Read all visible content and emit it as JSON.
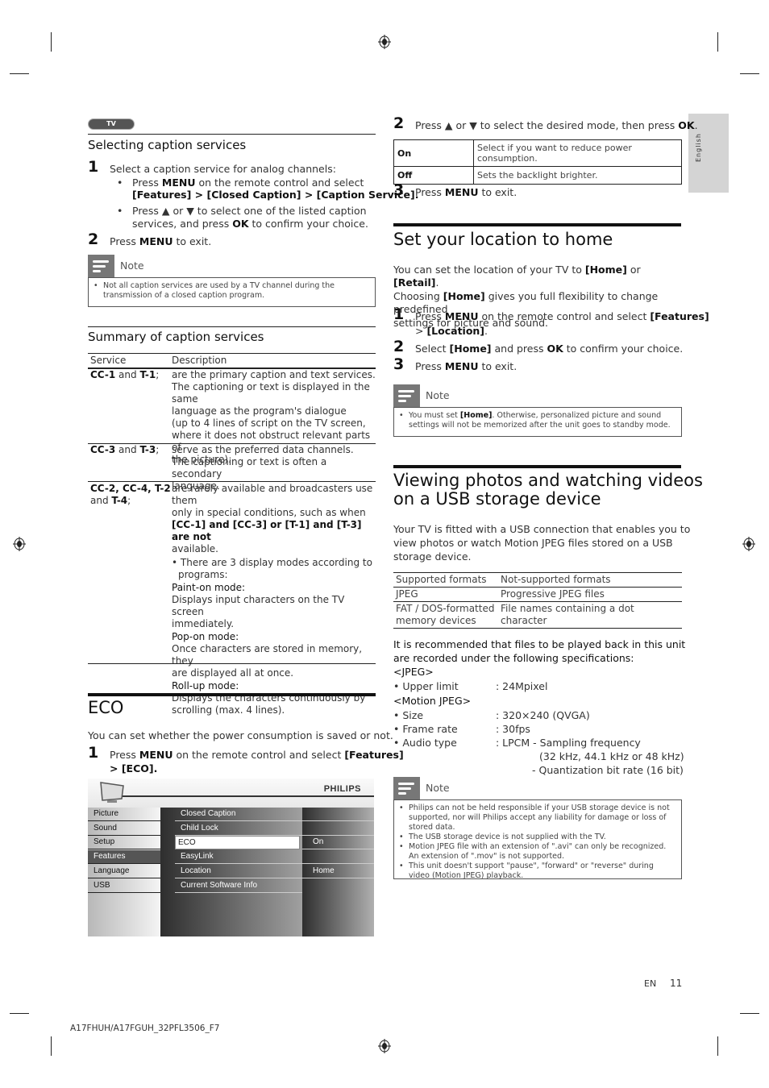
{
  "page": {
    "language_tab": "English",
    "footer": {
      "lang": "EN",
      "page_number": "11",
      "model": "A17FHUH/A17FGUH_32PFL3506_F7"
    }
  },
  "left": {
    "badge": "TV",
    "caption_section": {
      "title": "Selecting caption services",
      "step1_num": "1",
      "step1": "Select a caption service for analog channels:",
      "bullet1_pre": "Press ",
      "bullet1_menu": "MENU",
      "bullet1_mid": " on the remote control and select",
      "bullet1_path": "[Features] > [Closed Caption] > [Caption Service].",
      "bullet2_pre": "Press ▲ or ▼ to select one of the listed caption",
      "bullet2_line2_pre": "services, and press ",
      "bullet2_ok": "OK",
      "bullet2_post": " to confirm your choice.",
      "step2_num": "2",
      "step2_pre": "Press ",
      "step2_menu": "MENU",
      "step2_post": " to exit.",
      "note_label": "Note",
      "note_items": [
        "Not all caption services are used by a TV channel during the transmission of a closed caption program."
      ]
    },
    "summary": {
      "title": "Summary of caption services",
      "headers": [
        "Service",
        "Description"
      ],
      "rows": [
        {
          "service_bold1": "CC-1",
          "service_mid": " and ",
          "service_bold2": "T-1",
          "service_post": ";",
          "desc": [
            "are the primary caption and text services.",
            "The captioning or text is displayed in the same",
            "language as the program's dialogue",
            "(up to 4 lines of script on the TV screen,",
            "where it does not obstruct relevant parts of",
            "the picture)."
          ]
        },
        {
          "service_bold1": "CC-3",
          "service_mid": " and ",
          "service_bold2": "T-3",
          "service_post": ";",
          "desc": [
            "serve as the preferred data channels.",
            "The captioning or text is often a secondary",
            "language."
          ]
        },
        {
          "service_line1": "CC-2, CC-4, T-2",
          "service_line2_pre": "and ",
          "service_line2_bold": "T-4",
          "service_line2_post": ";",
          "desc_intro": [
            "are rarely available and broadcasters use them",
            "only in special conditions, such as when"
          ],
          "desc_codes": "[CC-1] and [CC-3] or [T-1] and [T-3] are not",
          "desc_avail": "available.",
          "desc_bullet": [
            "• There are 3 display modes according to",
            "programs:"
          ],
          "modes": [
            {
              "name": "Paint-on mode:",
              "text": [
                "Displays input characters on the TV screen",
                "immediately."
              ]
            },
            {
              "name": "Pop-on mode:",
              "text": [
                "Once characters are stored in memory, they",
                "are displayed all at once."
              ]
            },
            {
              "name": "Roll-up mode:",
              "text": [
                "Displays the characters continuously by",
                "scrolling (max. 4 lines)."
              ]
            }
          ]
        }
      ]
    },
    "eco": {
      "title": "ECO",
      "intro": "You can set whether the power consumption is saved or not.",
      "step1_num": "1",
      "step1_pre": "Press ",
      "step1_menu": "MENU",
      "step1_mid": " on the remote control and select ",
      "step1_features": "[Features]",
      "step1_line2": "> [ECO].",
      "tv_menu": {
        "brand": "PHILIPS",
        "left_items": [
          "Picture",
          "Sound",
          "Setup",
          "Features",
          "Language",
          "USB"
        ],
        "left_selected": "Features",
        "mid_items": [
          "Closed Caption",
          "Child Lock",
          "ECO",
          "EasyLink",
          "Location",
          "Current Software Info"
        ],
        "mid_selected": "ECO",
        "right_values": [
          "",
          "",
          "On",
          "",
          "Home",
          ""
        ]
      }
    }
  },
  "right": {
    "eco_cont": {
      "step2_num": "2",
      "step2_pre": "Press ▲ or ▼ to select the desired mode, then press ",
      "step2_ok": "OK",
      "step2_post": ".",
      "options": [
        {
          "key": "On",
          "desc": "Select if you want to reduce power consumption."
        },
        {
          "key": "Off",
          "desc": "Sets the backlight brighter."
        }
      ],
      "step3_num": "3",
      "step3_pre": "Press ",
      "step3_menu": "MENU",
      "step3_post": " to exit."
    },
    "location": {
      "title": "Set your location to home",
      "intro_l1_pre": "You can set the location of your TV to ",
      "intro_home": "[Home]",
      "intro_or": " or ",
      "intro_retail": "[Retail]",
      "intro_l1_post": ".",
      "intro_l2_pre": "Choosing ",
      "intro_l2_home": "[Home]",
      "intro_l2_post": " gives you full flexibility to change predefined",
      "intro_l3": "settings for picture and sound.",
      "step1_num": "1",
      "step1_pre": "Press ",
      "step1_menu": "MENU",
      "step1_mid": " on the remote control and select ",
      "step1_features": "[Features]",
      "step1_line2_pre": "> ",
      "step1_line2_loc": "[Location]",
      "step1_line2_post": ".",
      "step2_num": "2",
      "step2_pre": "Select ",
      "step2_home": "[Home]",
      "step2_mid": " and press ",
      "step2_ok": "OK",
      "step2_post": " to confirm your choice.",
      "step3_num": "3",
      "step3_pre": "Press ",
      "step3_menu": "MENU",
      "step3_post": " to exit.",
      "note_label": "Note",
      "note_pre": "You must set ",
      "note_home": "[Home]",
      "note_post": ". Otherwise, personalized picture and sound settings will not be memorized after the unit goes to standby mode."
    },
    "usb": {
      "title_l1": "Viewing photos and watching videos",
      "title_l2": "on a USB storage device",
      "intro": [
        "Your TV is fitted with a USB connection that enables you to",
        "view photos or watch Motion JPEG files stored on a USB",
        "storage device."
      ],
      "table": {
        "headers": [
          "Supported formats",
          "Not-supported formats"
        ],
        "rows": [
          [
            "JPEG",
            "Progressive JPEG files"
          ],
          [
            "FAT / DOS-formatted memory devices",
            "File names containing a dot character"
          ]
        ]
      },
      "recommend": [
        "It is recommended that files to be played back in this unit",
        "are recorded under the following specifications:"
      ],
      "jpeg_label": "<JPEG>",
      "jpeg_specs": [
        {
          "k": "• Upper limit",
          "v": ": 24Mpixel"
        }
      ],
      "mjpeg_label": "<Motion JPEG>",
      "mjpeg_specs": [
        {
          "k": "• Size",
          "v": ": 320×240 (QVGA)"
        },
        {
          "k": "• Frame rate",
          "v": ": 30fps"
        },
        {
          "k": "• Audio type",
          "v": ": LPCM - Sampling frequency"
        }
      ],
      "audio_extra": [
        "(32 kHz, 44.1 kHz or 48 kHz)",
        "- Quantization bit rate (16 bit)"
      ],
      "note_label": "Note",
      "note_items": [
        "Philips can not be held responsible if your USB storage device is not supported, nor will Philips accept any liability for damage or loss of stored data.",
        "The USB storage device is not supplied with the TV.",
        "Motion JPEG file with an extension of \".avi\" can only be recognized. An extension of \".mov\" is not supported.",
        "This unit doesn't support \"pause\", \"forward\" or \"reverse\" during video (Motion JPEG) playback."
      ]
    }
  }
}
